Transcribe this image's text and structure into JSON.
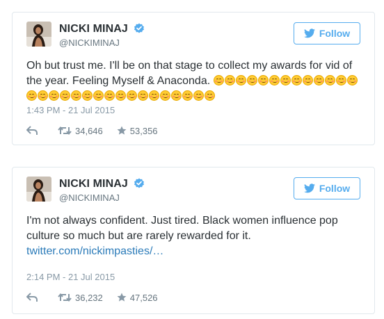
{
  "colors": {
    "accent": "#55acee",
    "link": "#2b7bb9",
    "border": "#e1e8ed",
    "muted": "#8899a6",
    "verified": "#55acee"
  },
  "tweets": [
    {
      "display_name": "NICKI MINAJ",
      "handle": "@NICKIMINAJ",
      "follow_label": "Follow",
      "text_line1": "Oh but trust me. I'll be on that stage to collect my awards for vid of",
      "text_line2": "the year. Feeling Myself & Anaconda.",
      "emoji_name": "smiling-face-with-smiling-eyes",
      "timestamp": "1:43 PM - 21 Jul 2015",
      "retweets": "34,646",
      "likes": "53,356"
    },
    {
      "display_name": "NICKI MINAJ",
      "handle": "@NICKIMINAJ",
      "follow_label": "Follow",
      "text_line1": "I'm not always confident.  Just tired. Black women influence pop",
      "text_line2": "culture so much but are rarely rewarded for it.",
      "link": "twitter.com/nickimpasties/…",
      "timestamp": "2:14 PM - 21 Jul 2015",
      "retweets": "36,232",
      "likes": "47,526"
    }
  ]
}
